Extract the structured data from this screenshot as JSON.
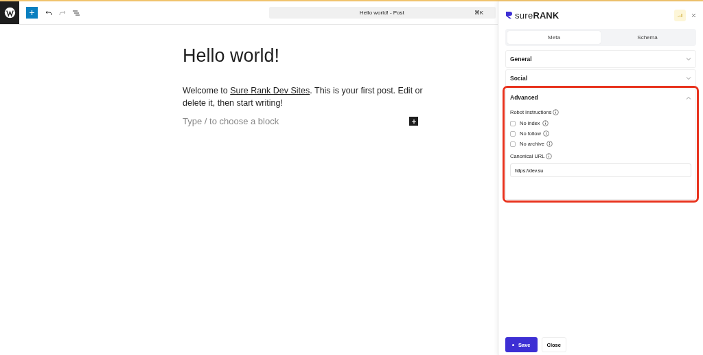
{
  "toolbar": {
    "document_title": "Hello world! - Post",
    "shortcut": "⌘K"
  },
  "post": {
    "title": "Hello world!",
    "paragraph": {
      "before": "Welcome to ",
      "link": "Sure Rank Dev Sites",
      "after": ". This is your first post. Edit or delete it, then start writing!"
    },
    "block_placeholder": "Type / to choose a block"
  },
  "panel": {
    "brand": {
      "light": "sure",
      "bold": "RANK"
    },
    "tabs": [
      {
        "label": "Meta",
        "selected": true
      },
      {
        "label": "Schema",
        "selected": false
      }
    ],
    "sections": [
      {
        "title": "General",
        "expanded": false,
        "highlighted": false
      },
      {
        "title": "Social",
        "expanded": false,
        "highlighted": false
      },
      {
        "title": "Advanced",
        "expanded": true,
        "highlighted": true,
        "robot_label": "Robot Instructions",
        "options": [
          {
            "label": "No index",
            "checked": false
          },
          {
            "label": "No follow",
            "checked": false
          },
          {
            "label": "No archive",
            "checked": false
          }
        ],
        "canonical_label": "Canonical URL",
        "canonical_value": "https://dev.su"
      }
    ],
    "buttons": {
      "save": "Save",
      "close": "Close"
    }
  }
}
